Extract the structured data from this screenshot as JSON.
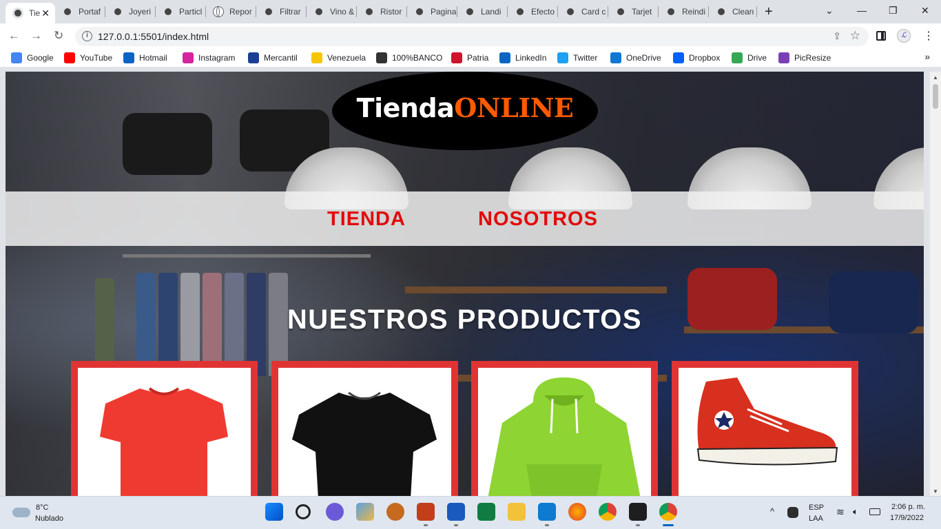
{
  "browser": {
    "tabs": [
      {
        "label": "Tie",
        "active": true
      },
      {
        "label": "Portaf"
      },
      {
        "label": "Joyeri"
      },
      {
        "label": "Particl"
      },
      {
        "label": "Repor",
        "globe": true
      },
      {
        "label": "Filtrar"
      },
      {
        "label": "Vino &"
      },
      {
        "label": "Ristor"
      },
      {
        "label": "Pagina"
      },
      {
        "label": "Landi"
      },
      {
        "label": "Efecto"
      },
      {
        "label": "Card c"
      },
      {
        "label": "Tarjet"
      },
      {
        "label": "Reindi"
      },
      {
        "label": "Clean"
      }
    ],
    "tab_close": "✕",
    "new_tab": "+",
    "window_controls": {
      "dropdown": "⌄",
      "minimize": "—",
      "restore": "❐",
      "close": "✕"
    },
    "url": "127.0.0.1:5501/index.html",
    "profile_initial": "ℒ",
    "bookmarks": [
      {
        "label": "Google",
        "color": "#4285f4"
      },
      {
        "label": "YouTube",
        "color": "#ff0000"
      },
      {
        "label": "Hotmail",
        "color": "#0a64c8"
      },
      {
        "label": "Instagram",
        "color": "#d6249f"
      },
      {
        "label": "Mercantil",
        "color": "#1c3f94"
      },
      {
        "label": "Venezuela",
        "color": "#f6c700"
      },
      {
        "label": "100%BANCO",
        "color": "#333333"
      },
      {
        "label": "Patria",
        "color": "#cf142b"
      },
      {
        "label": "LinkedIn",
        "color": "#0a66c2"
      },
      {
        "label": "Twitter",
        "color": "#1da1f2"
      },
      {
        "label": "OneDrive",
        "color": "#0f78d4"
      },
      {
        "label": "Dropbox",
        "color": "#0061ff"
      },
      {
        "label": "Drive",
        "color": "#34a853"
      },
      {
        "label": "PicResize",
        "color": "#7b3fb5"
      }
    ],
    "bookmarks_more": "»"
  },
  "page": {
    "logo": {
      "part1": "Tienda",
      "part2": "ONLINE"
    },
    "nav": [
      "TIENDA",
      "NOSOTROS"
    ],
    "section_title": "NUESTROS PRODUCTOS",
    "products": [
      {
        "name": "red-tshirt",
        "color": "#ef3a32"
      },
      {
        "name": "black-tshirt",
        "color": "#111111"
      },
      {
        "name": "green-hoodie",
        "color": "#8ed432"
      },
      {
        "name": "red-sneaker",
        "color": "#d7301f"
      }
    ],
    "colors": {
      "accent_red": "#e20a0a",
      "logo_orange": "#ff5a00",
      "card_border": "#e03434"
    }
  },
  "taskbar": {
    "weather": {
      "temp": "8°C",
      "condition": "Nublado"
    },
    "language": {
      "lang": "ESP",
      "layout": "LAA"
    },
    "clock": {
      "time": "2:06 p. m.",
      "date": "17/9/2022"
    }
  }
}
